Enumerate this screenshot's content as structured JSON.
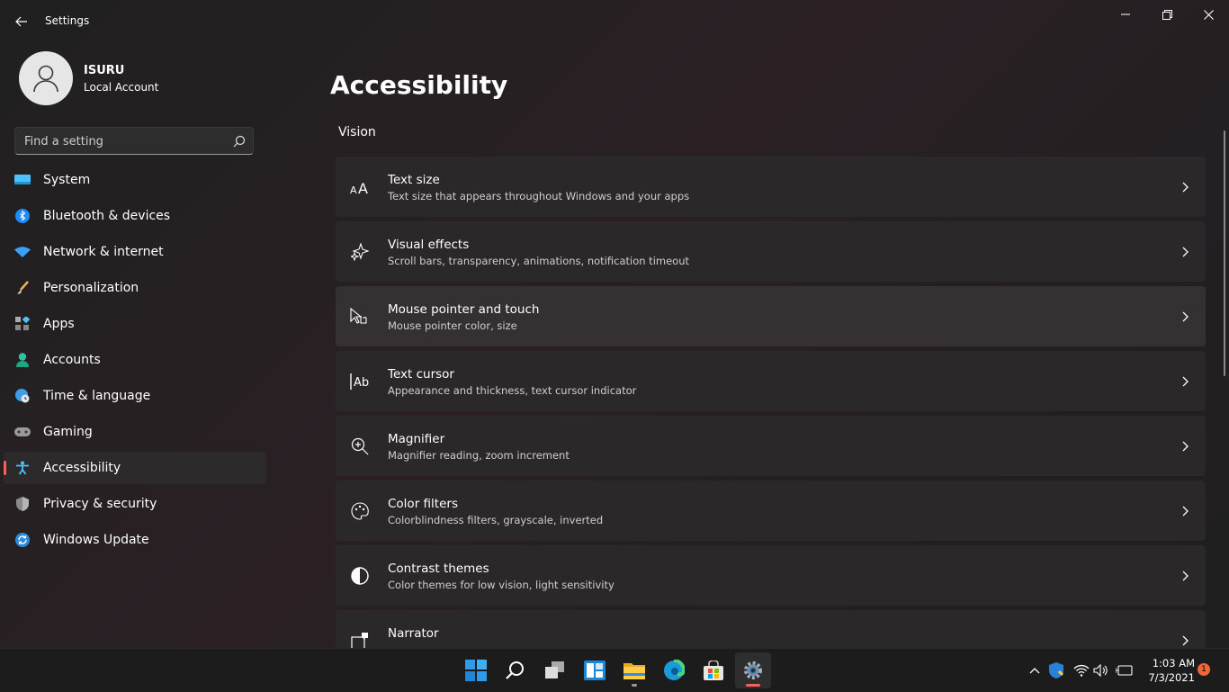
{
  "window": {
    "title": "Settings",
    "controls": {
      "minimize": "minimize",
      "maximize": "restore",
      "close": "close"
    }
  },
  "profile": {
    "name": "ISURU",
    "account_type": "Local Account"
  },
  "search": {
    "placeholder": "Find a setting"
  },
  "nav": {
    "items": [
      {
        "label": "System",
        "icon": "monitor-icon",
        "active": false
      },
      {
        "label": "Bluetooth & devices",
        "icon": "bluetooth-icon",
        "active": false
      },
      {
        "label": "Network & internet",
        "icon": "wifi-icon",
        "active": false
      },
      {
        "label": "Personalization",
        "icon": "brush-icon",
        "active": false
      },
      {
        "label": "Apps",
        "icon": "apps-icon",
        "active": false
      },
      {
        "label": "Accounts",
        "icon": "person-icon",
        "active": false
      },
      {
        "label": "Time & language",
        "icon": "globe-clock-icon",
        "active": false
      },
      {
        "label": "Gaming",
        "icon": "gamepad-icon",
        "active": false
      },
      {
        "label": "Accessibility",
        "icon": "accessibility-icon",
        "active": true
      },
      {
        "label": "Privacy & security",
        "icon": "shield-icon",
        "active": false
      },
      {
        "label": "Windows Update",
        "icon": "update-icon",
        "active": false
      }
    ]
  },
  "main": {
    "title": "Accessibility",
    "section": "Vision",
    "cards": [
      {
        "title": "Text size",
        "subtitle": "Text size that appears throughout Windows and your apps",
        "icon": "text-size-icon"
      },
      {
        "title": "Visual effects",
        "subtitle": "Scroll bars, transparency, animations, notification timeout",
        "icon": "sparkle-icon"
      },
      {
        "title": "Mouse pointer and touch",
        "subtitle": "Mouse pointer color, size",
        "icon": "pointer-touch-icon"
      },
      {
        "title": "Text cursor",
        "subtitle": "Appearance and thickness, text cursor indicator",
        "icon": "text-cursor-icon"
      },
      {
        "title": "Magnifier",
        "subtitle": "Magnifier reading, zoom increment",
        "icon": "magnifier-icon"
      },
      {
        "title": "Color filters",
        "subtitle": "Colorblindness filters, grayscale, inverted",
        "icon": "palette-icon"
      },
      {
        "title": "Contrast themes",
        "subtitle": "Color themes for low vision, light sensitivity",
        "icon": "contrast-icon"
      },
      {
        "title": "Narrator",
        "subtitle": "",
        "icon": "narrator-icon"
      }
    ]
  },
  "taskbar": {
    "apps": [
      "start",
      "search",
      "task-view",
      "widgets",
      "file-explorer",
      "edge",
      "store",
      "settings"
    ],
    "clock": {
      "time": "1:03 AM",
      "date": "7/3/2021"
    },
    "notification_count": "1"
  },
  "colors": {
    "accent": "#ff5c5c",
    "background": "#202020"
  }
}
